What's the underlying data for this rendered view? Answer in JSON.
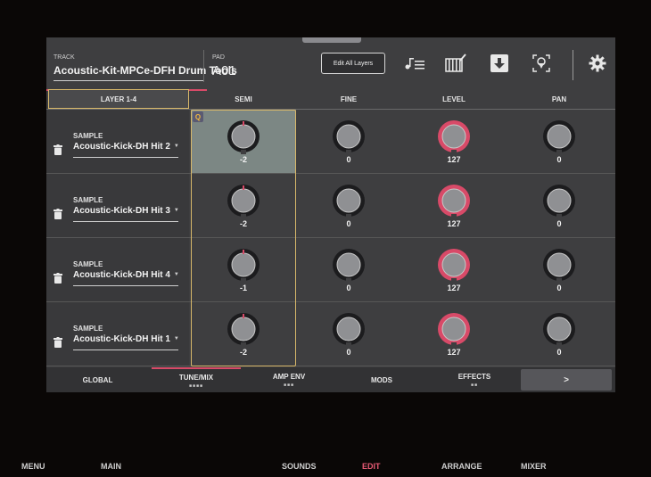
{
  "header": {
    "track_label": "TRACK",
    "track_name": "Acoustic-Kit-MPCe-DFH Drum Tools",
    "pad_label": "PAD",
    "pad_name": "A01",
    "edit_all_label": "Edit All Layers",
    "icons": [
      "music-list-icon",
      "keyboard-pencil-icon",
      "download-icon",
      "location-pin-icon",
      "gear-icon"
    ]
  },
  "columns": {
    "layer_tab": "LAYER 1-4",
    "semi": "SEMI",
    "fine": "FINE",
    "level": "LEVEL",
    "pan": "PAN"
  },
  "sample_label": "SAMPLE",
  "layers": [
    {
      "sample": "Acoustic-Kick-DH Hit 2",
      "semi": "-2",
      "fine": "0",
      "level": "127",
      "pan": "0"
    },
    {
      "sample": "Acoustic-Kick-DH Hit 3",
      "semi": "-2",
      "fine": "0",
      "level": "127",
      "pan": "0"
    },
    {
      "sample": "Acoustic-Kick-DH Hit 4",
      "semi": "-1",
      "fine": "0",
      "level": "127",
      "pan": "0"
    },
    {
      "sample": "Acoustic-Kick-DH Hit 1",
      "semi": "-2",
      "fine": "0",
      "level": "127",
      "pan": "0"
    }
  ],
  "q_badge": "Q",
  "bottom_tabs": {
    "global": "GLOBAL",
    "tune_mix": "TUNE/MIX",
    "amp_env": "AMP ENV",
    "mods": "MODS",
    "effects": "EFFECTS",
    "next": ">",
    "dots4": "■■■■",
    "dots3": "■■■",
    "dots2": "■■"
  },
  "hardware_buttons": {
    "menu": "MENU",
    "main": "MAIN",
    "sounds": "SOUNDS",
    "edit": "EDIT",
    "arrange": "ARRANGE",
    "mixer": "MIXER"
  },
  "colors": {
    "accent": "#d84a68",
    "selection": "#d8b86a",
    "screen_bg": "#3e3e40"
  }
}
